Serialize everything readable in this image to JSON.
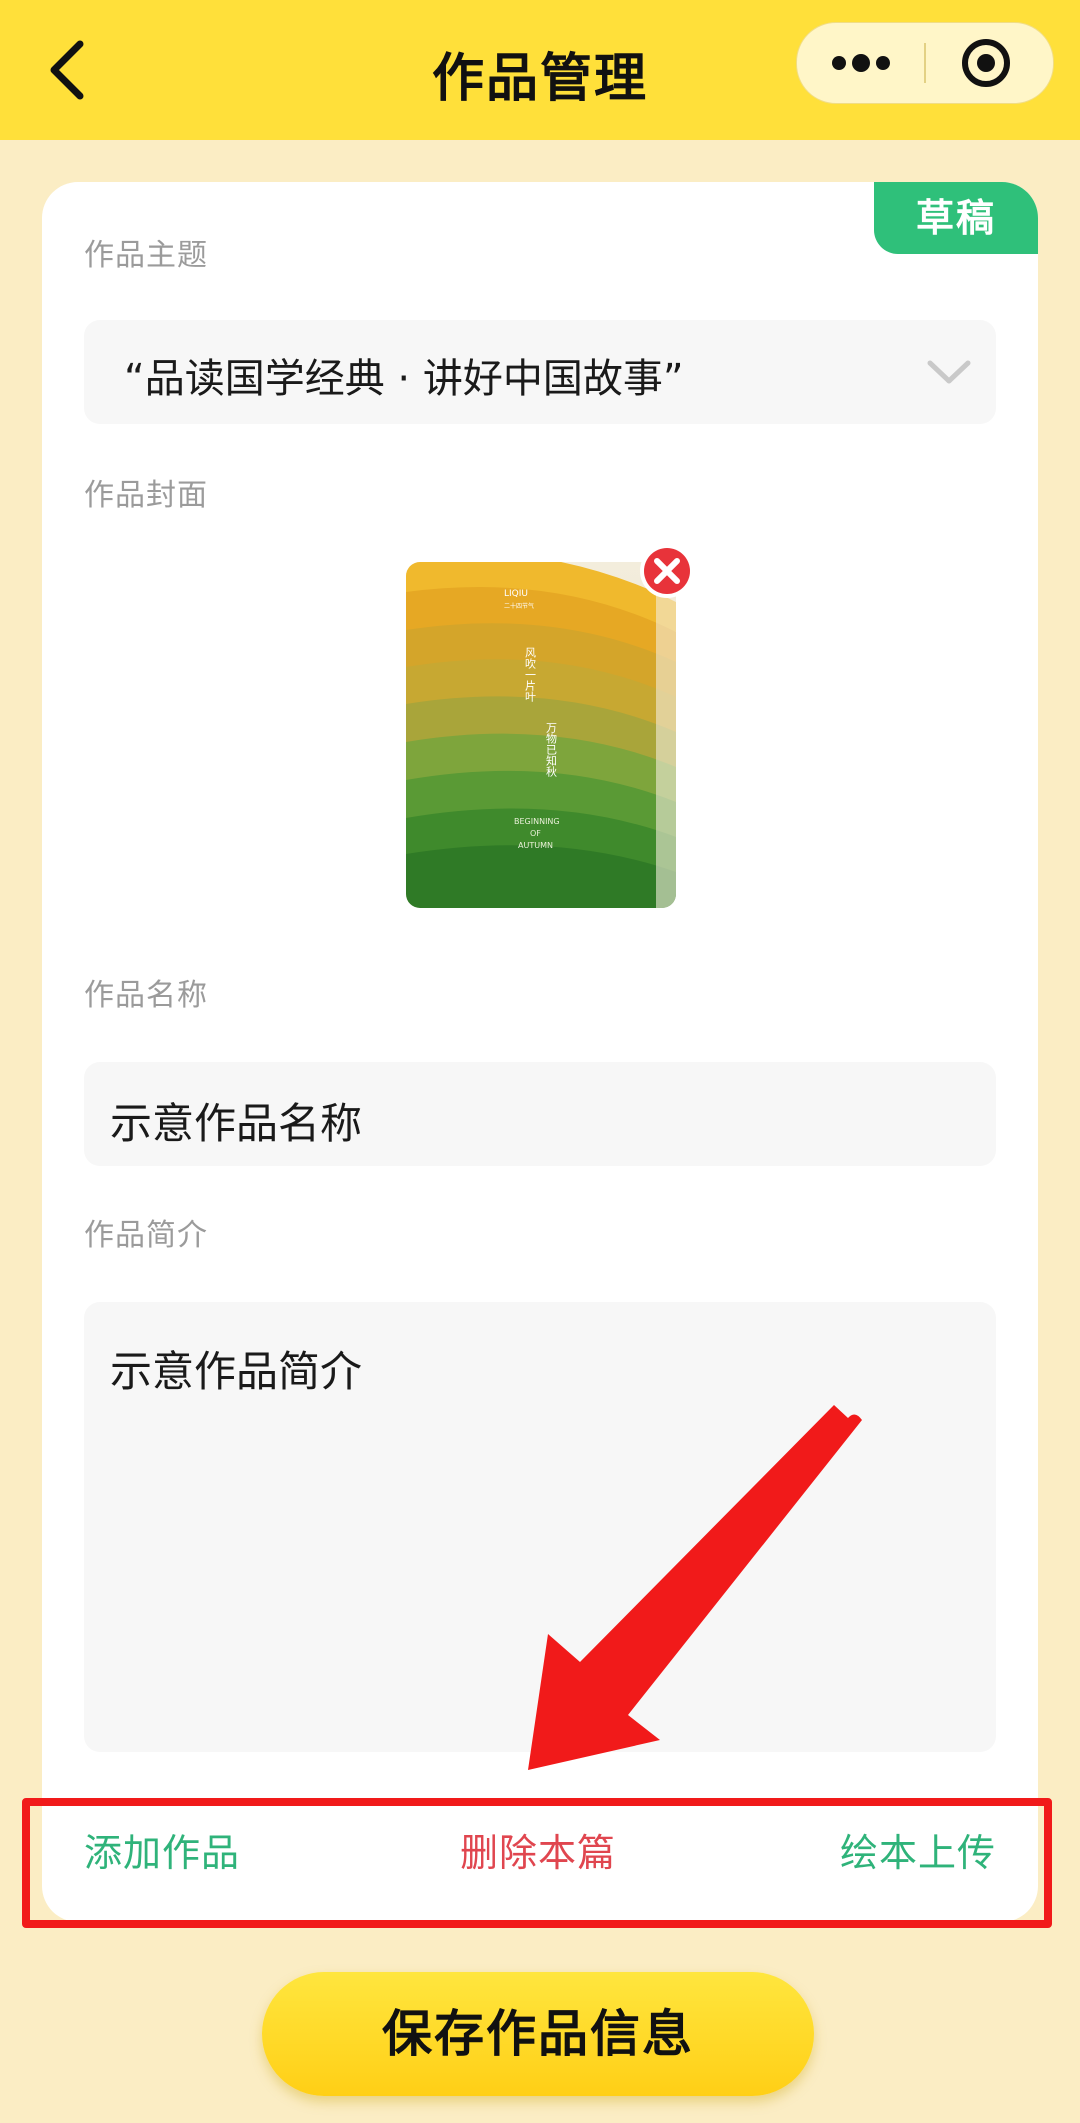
{
  "header": {
    "title": "作品管理",
    "back_icon": "chevron-left-icon",
    "more_icon": "more-dots-icon",
    "close_icon": "target-circle-icon"
  },
  "card": {
    "status_badge": "草稿",
    "theme": {
      "label": "作品主题",
      "value": "“品读国学经典 · 讲好中国故事”",
      "icon": "chevron-down-icon"
    },
    "cover": {
      "label": "作品封面",
      "remove_icon": "close-circle-icon",
      "image_text": {
        "brand": "LIQIU",
        "subbrand": "二十四节气",
        "vertical_line_1": "风吹一片叶",
        "vertical_line_2": "万物已知秋",
        "english": [
          "BEGINNING",
          "OF",
          "AUTUMN"
        ]
      }
    },
    "name": {
      "label": "作品名称",
      "value": "示意作品名称"
    },
    "intro": {
      "label": "作品简介",
      "value": "示意作品简介"
    },
    "actions": {
      "add": "添加作品",
      "delete": "删除本篇",
      "upload": "绘本上传"
    }
  },
  "save_button": "保存作品信息",
  "colors": {
    "header_bg": "#ffe03a",
    "page_bg": "#fbedc4",
    "badge_green": "#2fc07a",
    "action_green": "#2fb37a",
    "action_red": "#e0464f",
    "annotation_red": "#f11a1a"
  }
}
